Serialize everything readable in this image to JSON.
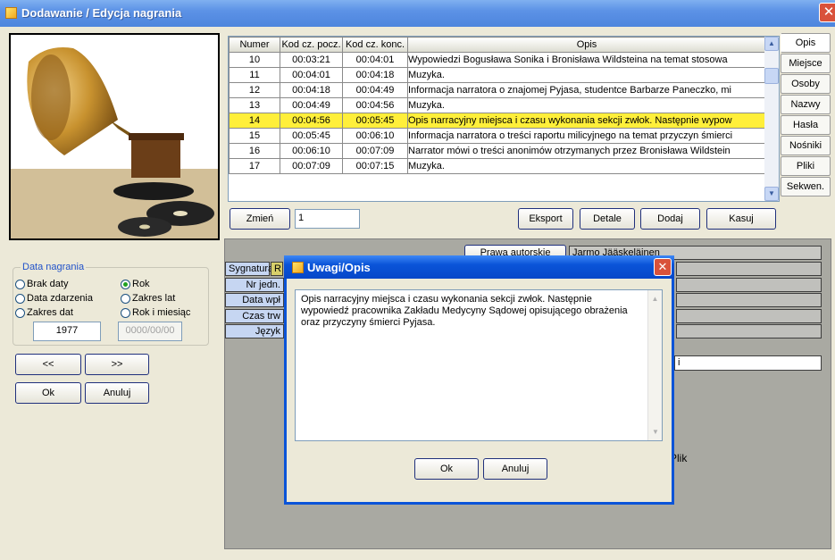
{
  "window": {
    "title": "Dodawanie / Edycja nagrania",
    "close": "✕"
  },
  "grid": {
    "headers": [
      "Numer",
      "Kod cz. pocz.",
      "Kod cz. konc.",
      "Opis"
    ],
    "rows": [
      {
        "n": "10",
        "start": "00:03:21",
        "end": "00:04:01",
        "desc": "Wypowiedzi Bogusława Sonika i Bronisława Wildsteina na temat stosowa"
      },
      {
        "n": "11",
        "start": "00:04:01",
        "end": "00:04:18",
        "desc": "Muzyka."
      },
      {
        "n": "12",
        "start": "00:04:18",
        "end": "00:04:49",
        "desc": "Informacja narratora o znajomej Pyjasa, studentce Barbarze Paneczko, mi"
      },
      {
        "n": "13",
        "start": "00:04:49",
        "end": "00:04:56",
        "desc": "Muzyka."
      },
      {
        "n": "14",
        "start": "00:04:56",
        "end": "00:05:45",
        "desc": "Opis narracyjny miejsca i czasu wykonania sekcji zwłok. Następnie wypow"
      },
      {
        "n": "15",
        "start": "00:05:45",
        "end": "00:06:10",
        "desc": "Informacja narratora o treści raportu milicyjnego na temat przyczyn śmierci"
      },
      {
        "n": "16",
        "start": "00:06:10",
        "end": "00:07:09",
        "desc": "Narrator mówi o treści anonimów otrzymanych przez Bronisława Wildstein"
      },
      {
        "n": "17",
        "start": "00:07:09",
        "end": "00:07:15",
        "desc": "Muzyka."
      }
    ],
    "selected_row": 4
  },
  "tabs": [
    "Opis",
    "Miejsce",
    "Osoby",
    "Nazwy",
    "Hasła",
    "Nośniki",
    "Pliki",
    "Sekwen."
  ],
  "grid_toolbar": {
    "change": "Zmień",
    "change_value": "1",
    "export": "Eksport",
    "details": "Detale",
    "add": "Dodaj",
    "delete": "Kasuj"
  },
  "date_group": {
    "legend": "Data nagrania",
    "options": {
      "brak": "Brak daty",
      "rok": "Rok",
      "zdarzenia": "Data zdarzenia",
      "zakres_lat": "Zakres lat",
      "zakres_dat": "Zakres dat",
      "rok_miesiac": "Rok i miesiąc"
    },
    "year": "1977",
    "date_placeholder": "0000/00/00"
  },
  "nav": {
    "prev": "<<",
    "next": ">>",
    "ok": "Ok",
    "cancel": "Anuluj"
  },
  "lower": {
    "rights_button": "Prawa autorskie",
    "rights_value": "Jarmo Jääskeläinen",
    "labels": {
      "sygnatura": "Sygnatura",
      "nr": "Nr jedn.",
      "data": "Data wpł",
      "czas": "Czas trw",
      "jezyk": "Język"
    },
    "fragments": {
      "r": "R",
      "i": "i",
      "plik": "Plik"
    }
  },
  "dialog": {
    "title": "Uwagi/Opis",
    "close": "✕",
    "text": "Opis narracyjny miejsca i czasu wykonania sekcji zwłok. Następnie wypowiedź pracownika Zakładu Medycyny Sądowej opisującego obrażenia oraz przyczyny śmierci Pyjasa.",
    "ok": "Ok",
    "cancel": "Anuluj"
  },
  "colors": {
    "title_bar": "#5c92e6",
    "selected_row": "#ffef3a",
    "dialog_border": "#0a54d8",
    "label_bg": "#c6d6f2"
  }
}
